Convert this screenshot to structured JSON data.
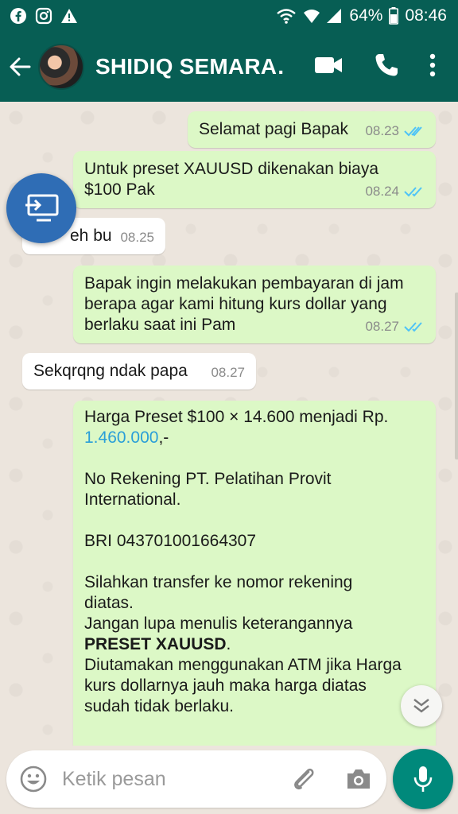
{
  "status_bar": {
    "left_icons": [
      "facebook-icon",
      "instagram-icon",
      "warning-icon"
    ],
    "battery_percent": "64%",
    "time": "08:46"
  },
  "header": {
    "contact_name": "SHIDIQ SEMARA…"
  },
  "messages": [
    {
      "direction": "out",
      "text": "Selamat pagi Bapak",
      "time": "08.23",
      "read": true
    },
    {
      "direction": "out",
      "text": "Untuk preset XAUUSD dikenakan biaya\n$100 Pak",
      "time": "08.24",
      "read": true
    },
    {
      "direction": "in",
      "text": "eh bu",
      "time": "08.25"
    },
    {
      "direction": "out",
      "text": "Bapak ingin melakukan pembayaran di jam\nberapa agar kami hitung kurs dollar yang\nberlaku saat ini Pam",
      "time": "08.27",
      "read": true
    },
    {
      "direction": "in",
      "text": "Sekqrqng ndak papa",
      "time": "08.27"
    },
    {
      "direction": "out",
      "line1": "Harga Preset $100 × 14.600 menjadi Rp.",
      "link": "1.460.000",
      "link_suffix": ",-",
      "account_block": "No Rekening PT. Pelatihan Provit\nInternational.",
      "bank": "BRI 043701001664307",
      "instructions": "Silahkan transfer ke nomor rekening\ndiatas.\nJangan lupa menulis keterangannya",
      "emphasis": "PRESET XAUUSD",
      "emphasis_suffix": ".",
      "closing": "Diutamakan menggunakan ATM jika Harga\nkurs dollarnya jauh maka harga diatas\nsudah tidak berlaku."
    }
  ],
  "input": {
    "placeholder": "Ketik pesan"
  },
  "colors": {
    "header": "#075e54",
    "outgoing_bubble": "#dcf8c6",
    "incoming_bubble": "#ffffff",
    "read_ticks": "#4fc3f7",
    "mic_button": "#00897b"
  }
}
